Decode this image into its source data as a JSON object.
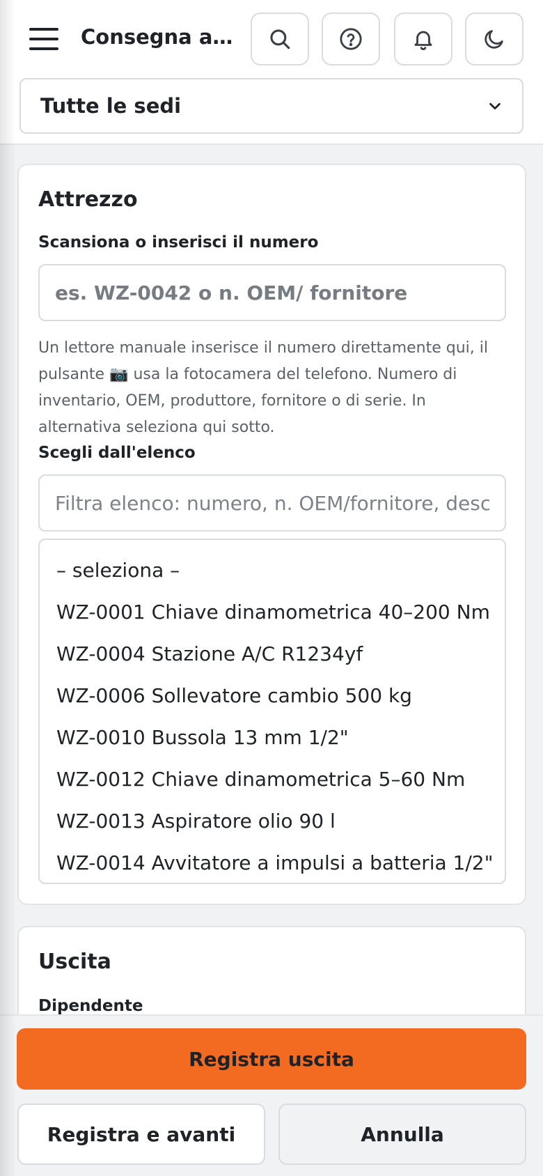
{
  "header": {
    "title": "Consegna attrezzo",
    "site_selector": {
      "selected": "Tutte le sedi"
    }
  },
  "icons": {
    "menu": "hamburger-icon",
    "search": "search-icon",
    "help": "help-icon",
    "notifications": "bell-icon",
    "theme": "moon-icon"
  },
  "tool_card": {
    "title": "Attrezzo",
    "scan_label": "Scansiona o inserisci il numero",
    "scan_placeholder": "es. WZ-0042 o n. OEM/ fornitore",
    "help_text": "Un lettore manuale inserisce il numero direttamente qui, il pulsante 📷 usa la fotocamera del telefono. Numero di inventario, OEM, produttore, fornitore o di serie. In alternativa seleziona qui sotto.",
    "list_label": "Scegli dall'elenco",
    "filter_placeholder": "Filtra elenco: numero, n. OEM/fornitore, descrizione",
    "options": [
      "– seleziona –",
      "WZ-0001 Chiave dinamometrica 40–200 Nm",
      "WZ-0004 Stazione A/C R1234yf",
      "WZ-0006 Sollevatore cambio 500 kg",
      "WZ-0010 Bussola 13 mm 1/2\"",
      "WZ-0012 Chiave dinamometrica 5–60 Nm",
      "WZ-0013 Aspiratore olio 90 l",
      "WZ-0014 Avvitatore a impulsi a batteria 1/2\""
    ]
  },
  "checkout_card": {
    "title": "Uscita",
    "employee_label": "Dipendente"
  },
  "actions": {
    "primary": "Registra uscita",
    "save_next": "Registra e avanti",
    "cancel": "Annulla"
  },
  "colors": {
    "accent": "#f26b21",
    "background": "#f1f2f4",
    "border": "#d8dbe0"
  }
}
